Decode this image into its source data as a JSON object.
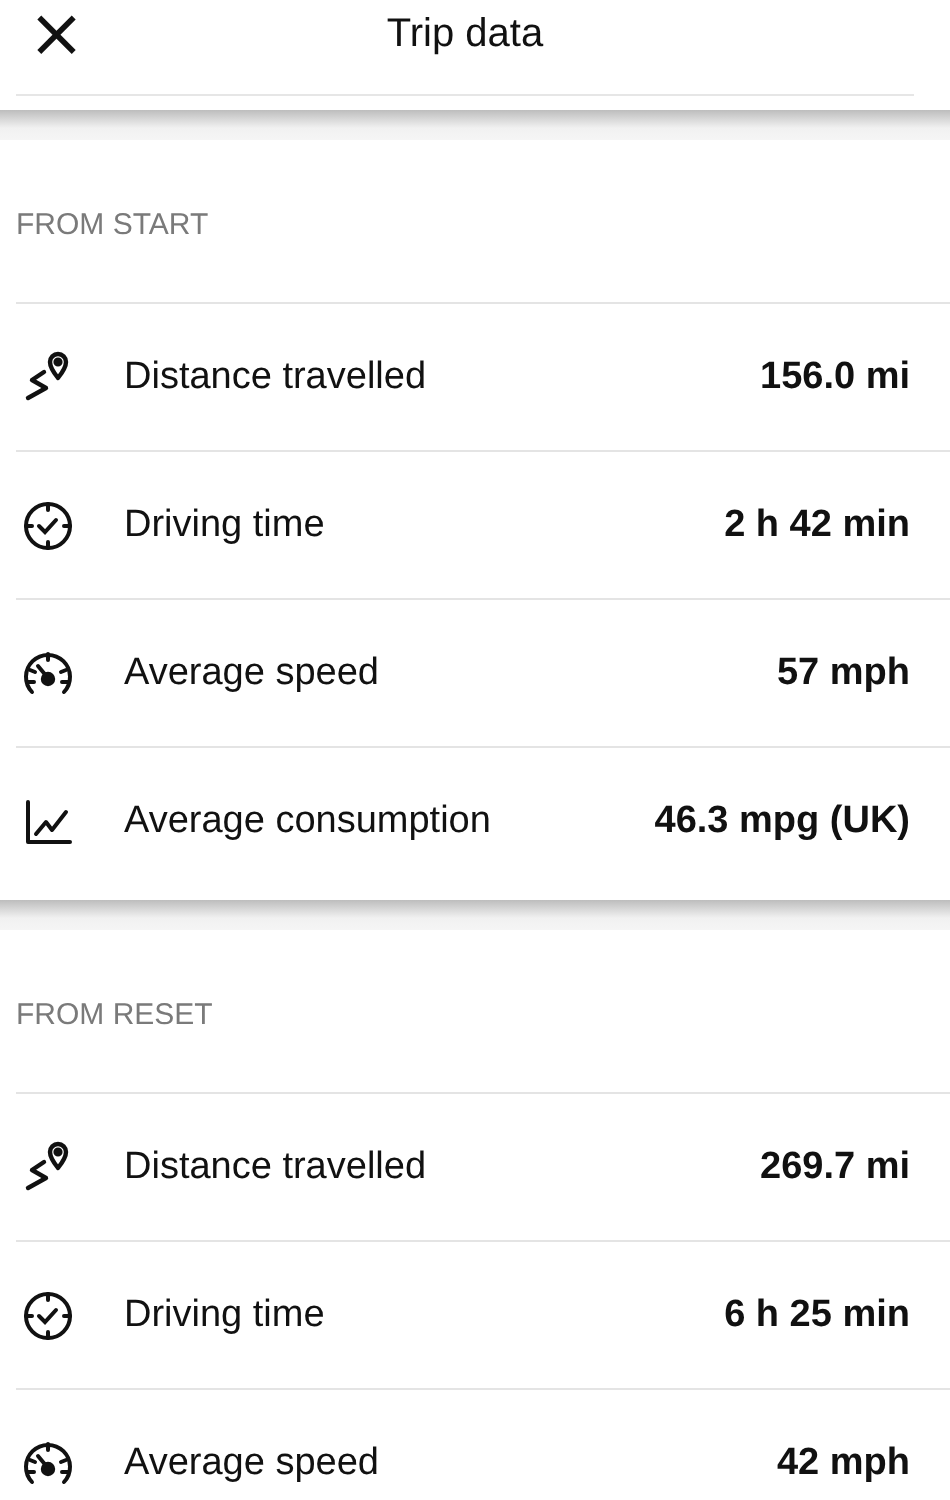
{
  "header": {
    "close": "×",
    "title": "Trip data"
  },
  "sections": [
    {
      "title": "FROM START",
      "rows": [
        {
          "kind": "distance",
          "label": "Distance travelled",
          "value": "156.0 mi"
        },
        {
          "kind": "time",
          "label": "Driving time",
          "value": "2 h 42 min"
        },
        {
          "kind": "speed",
          "label": "Average speed",
          "value": "57 mph"
        },
        {
          "kind": "consumption",
          "label": "Average consumption",
          "value": "46.3 mpg (UK)"
        }
      ]
    },
    {
      "title": "FROM RESET",
      "rows": [
        {
          "kind": "distance",
          "label": "Distance travelled",
          "value": "269.7 mi"
        },
        {
          "kind": "time",
          "label": "Driving time",
          "value": "6 h 25 min"
        },
        {
          "kind": "speed",
          "label": "Average speed",
          "value": "42 mph"
        }
      ]
    }
  ]
}
